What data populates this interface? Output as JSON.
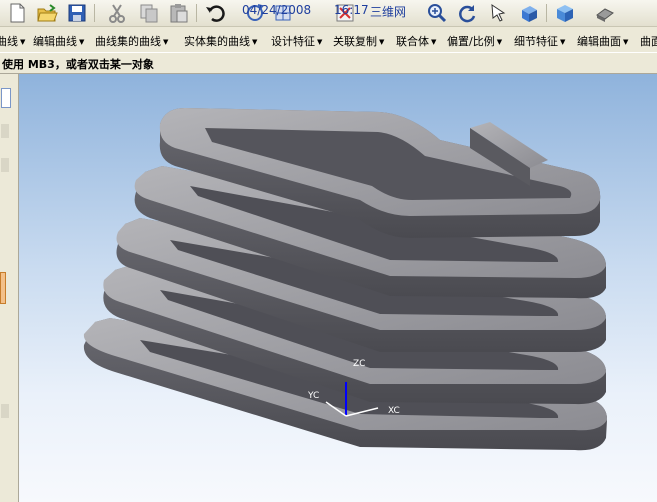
{
  "toolbar": {
    "buttons": [
      {
        "icon": "new-file-icon"
      },
      {
        "icon": "open-folder-icon"
      },
      {
        "icon": "save-icon"
      },
      {
        "icon": "cut-icon"
      },
      {
        "icon": "copy-icon"
      },
      {
        "icon": "paste-icon"
      },
      {
        "icon": "undo-icon"
      },
      {
        "icon": "rotate-view-icon"
      },
      {
        "icon": "layer-icon"
      },
      {
        "icon": "fit-view-icon"
      },
      {
        "icon": "zoom-icon"
      },
      {
        "icon": "refresh-icon"
      },
      {
        "icon": "select-icon"
      },
      {
        "icon": "shading-icon"
      },
      {
        "icon": "display-mode-icon"
      },
      {
        "icon": "print-icon"
      }
    ],
    "overlay": {
      "date": "04/24/2008",
      "time": "16:17",
      "site": "三维网"
    }
  },
  "menu": {
    "items": [
      {
        "label": "曲线"
      },
      {
        "label": "编辑曲线"
      },
      {
        "label": "曲线集的曲线"
      },
      {
        "label": "实体集的曲线"
      },
      {
        "label": "设计特征"
      },
      {
        "label": "关联复制"
      },
      {
        "label": "联合体"
      },
      {
        "label": "偏置/比例"
      },
      {
        "label": "细节特征"
      },
      {
        "label": "编辑曲面"
      },
      {
        "label": "曲面"
      }
    ]
  },
  "status": {
    "text": "使用 MB3，或者双击某一对象"
  },
  "viewport": {
    "axes": {
      "z": "ZC",
      "y": "YC",
      "x": "XC"
    },
    "colors": {
      "background_top": "#8fb3dc",
      "background_bottom": "#f7f9fd",
      "model_face": "#9a9a9e",
      "model_side": "#5c5c62"
    }
  }
}
